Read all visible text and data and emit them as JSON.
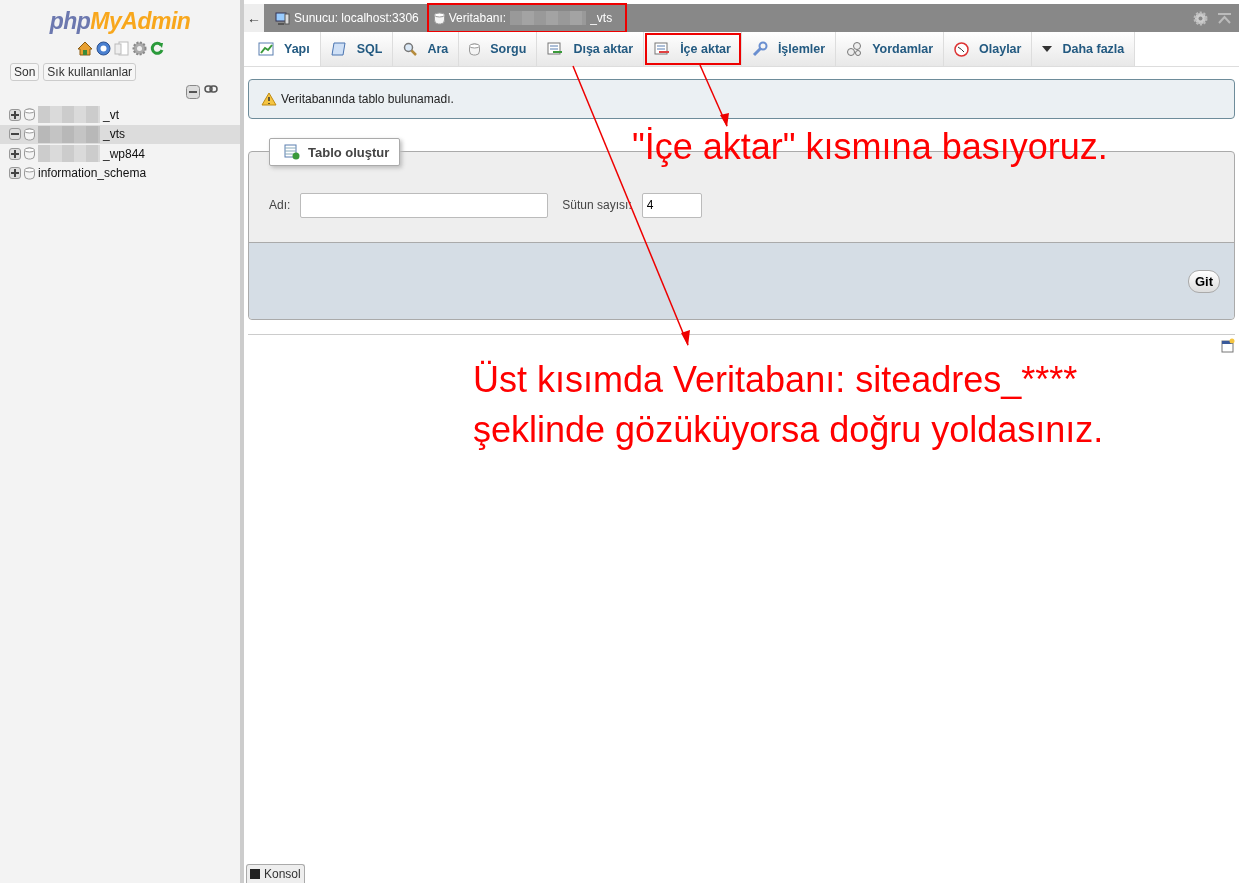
{
  "sidebar": {
    "logo_left": "php",
    "logo_right": "MyAdmin",
    "buttons": [
      "Son",
      "Sık kullanılanlar"
    ],
    "tree": [
      {
        "label": "_vt",
        "redacted": true,
        "expanded": false,
        "selected": false
      },
      {
        "label": "_vts",
        "redacted": true,
        "expanded": true,
        "selected": true
      },
      {
        "label": "_wp844",
        "redacted": true,
        "expanded": false,
        "selected": false
      },
      {
        "label": "information_schema",
        "redacted": false,
        "expanded": false,
        "selected": false
      }
    ]
  },
  "breadcrumb": {
    "back": "←",
    "items": [
      {
        "kind": "server",
        "label": "Sunucu: localhost:3306",
        "highlighted": false
      },
      {
        "kind": "database",
        "label": "Veritabanı:",
        "suffix": "_vts",
        "highlighted": true
      }
    ]
  },
  "tabs": [
    {
      "label": "Yapı",
      "selected": true,
      "highlighted": false
    },
    {
      "label": "SQL",
      "selected": false,
      "highlighted": false
    },
    {
      "label": "Ara",
      "selected": false,
      "highlighted": false
    },
    {
      "label": "Sorgu",
      "selected": false,
      "highlighted": false
    },
    {
      "label": "Dışa aktar",
      "selected": false,
      "highlighted": false
    },
    {
      "label": "İçe aktar",
      "selected": false,
      "highlighted": true
    },
    {
      "label": "İşlemler",
      "selected": false,
      "highlighted": false
    },
    {
      "label": "Yordamlar",
      "selected": false,
      "highlighted": false
    },
    {
      "label": "Olaylar",
      "selected": false,
      "highlighted": false
    },
    {
      "label": "Daha fazla",
      "selected": false,
      "highlighted": false
    }
  ],
  "notice": "Veritabanında tablo bulunamadı.",
  "create_table": {
    "title": "Tablo oluştur",
    "name_label": "Adı:",
    "columns_label": "Sütun sayısı:",
    "columns_value": "4",
    "submit": "Git"
  },
  "console": "Konsol",
  "annotations": [
    {
      "lines": [
        "\"İçe aktar\" kısmına basıyoruz."
      ]
    },
    {
      "lines": [
        "Üst kısımda Veritabanı: siteadres_****",
        "şeklinde gözüküyorsa doğru yoldasınız."
      ]
    }
  ]
}
